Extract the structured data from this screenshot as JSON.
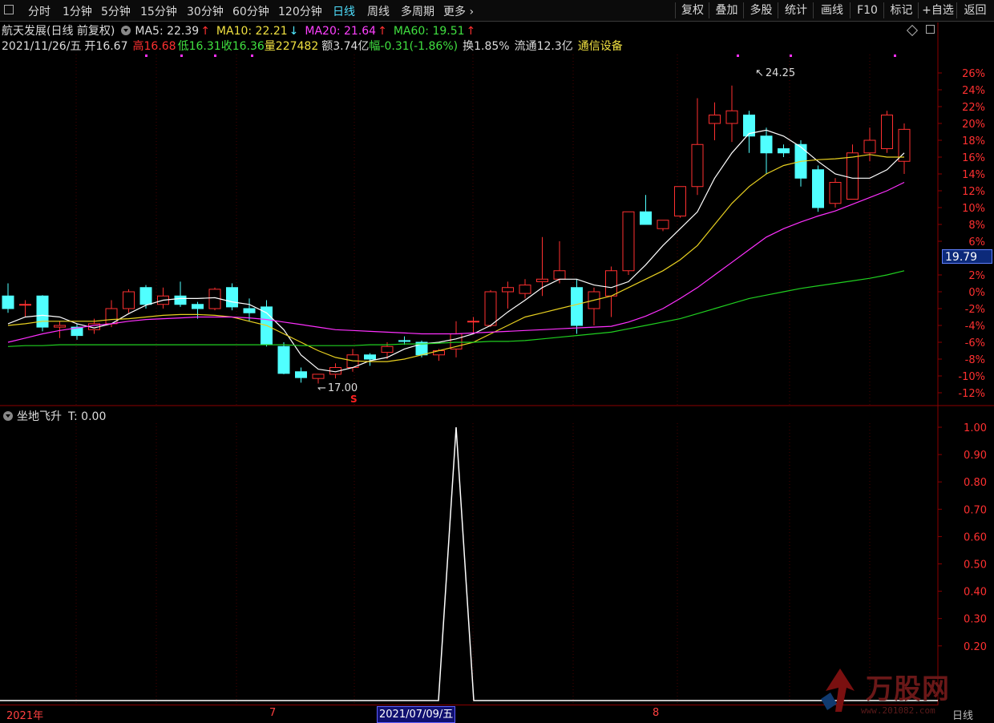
{
  "toolbar": {
    "items": [
      "分时",
      "1分钟",
      "5分钟",
      "15分钟",
      "30分钟",
      "60分钟",
      "120分钟",
      "日线",
      "周线",
      "多周期",
      "更多"
    ],
    "active": "日线",
    "more_arrow": "›",
    "right": [
      "复权",
      "叠加",
      "多股",
      "统计",
      "画线",
      "F10",
      "标记",
      "+自选",
      "返回"
    ]
  },
  "stock": {
    "title": "航天发展(日线 前复权)",
    "ma5_label": "MA5: 22.39",
    "ma10_label": "MA10: 22.21",
    "ma20_label": "MA20: 21.64",
    "ma60_label": "MA60: 19.51",
    "date": "2021/11/26/五",
    "open": "开16.67",
    "high": "高16.68",
    "low": "低16.31",
    "close": "收16.36",
    "volume": "量227482",
    "amount": "额3.74亿",
    "change": "幅-0.31(-1.86%)",
    "turnover": "换1.85%",
    "float": "流通12.3亿",
    "sector": "通信设备",
    "current_price": "19.79",
    "high_mark": "24.25",
    "low_mark": "17.00",
    "signal_mark": "S"
  },
  "price_axis": [
    "26%",
    "24%",
    "22%",
    "20%",
    "18%",
    "16%",
    "14%",
    "12%",
    "10%",
    "8%",
    "6%",
    "2%",
    "0%",
    "-2%",
    "-4%",
    "-6%",
    "-8%",
    "-10%",
    "-12%"
  ],
  "indicator": {
    "name": "坐地飞升",
    "value": "T: 0.00",
    "axis": [
      "1.00",
      "0.90",
      "0.80",
      "0.70",
      "0.60",
      "0.50",
      "0.40",
      "0.30",
      "0.20"
    ]
  },
  "date_axis": {
    "year": "2021年",
    "m7": "7",
    "selected": "2021/07/09/五",
    "m8": "8",
    "period": "日线"
  },
  "watermark": {
    "text": "万股网",
    "url": "www.201082.com"
  },
  "colors": {
    "up": "#ff3030",
    "down": "#50ffff",
    "ma5": "#ffffff",
    "ma10": "#e8d020",
    "ma20": "#ff30ff",
    "ma60": "#20d020"
  },
  "chart_data": {
    "type": "candlestick",
    "y_unit": "% change",
    "ylim": [
      -13,
      27
    ],
    "candles_ohlc": [
      [
        -0.5,
        1.0,
        -2.5,
        -2.0
      ],
      [
        -1.5,
        -1.0,
        -3.0,
        -1.5
      ],
      [
        -0.5,
        -0.4,
        -4.7,
        -4.2
      ],
      [
        -4.2,
        -3.5,
        -5.5,
        -4.0
      ],
      [
        -4.2,
        -3.8,
        -5.7,
        -5.2
      ],
      [
        -4.5,
        -3.2,
        -5.0,
        -3.8
      ],
      [
        -3.8,
        -1.0,
        -4.2,
        -2.0
      ],
      [
        -2.0,
        0.3,
        -2.5,
        0.0
      ],
      [
        0.5,
        0.8,
        -2.0,
        -1.5
      ],
      [
        -1.5,
        0.5,
        -2.0,
        -0.5
      ],
      [
        -0.5,
        1.2,
        -1.8,
        -1.5
      ],
      [
        -1.5,
        -1.2,
        -3.2,
        -2.0
      ],
      [
        -2.0,
        0.5,
        -2.2,
        0.3
      ],
      [
        0.5,
        1.0,
        -2.2,
        -1.8
      ],
      [
        -2.0,
        -0.8,
        -3.5,
        -2.5
      ],
      [
        -1.8,
        -1.0,
        -6.5,
        -6.2
      ],
      [
        -6.5,
        -6.0,
        -9.8,
        -9.7
      ],
      [
        -9.5,
        -9.0,
        -10.8,
        -10.2
      ],
      [
        -10.3,
        -9.8,
        -10.9,
        -9.8
      ],
      [
        -9.8,
        -8.5,
        -10.3,
        -9.0
      ],
      [
        -9.0,
        -6.8,
        -9.5,
        -7.5
      ],
      [
        -7.5,
        -7.3,
        -8.8,
        -8.0
      ],
      [
        -7.2,
        -6.0,
        -8.0,
        -6.5
      ],
      [
        -5.8,
        -5.3,
        -6.3,
        -5.9
      ],
      [
        -6.0,
        -5.8,
        -7.8,
        -7.5
      ],
      [
        -7.5,
        -6.8,
        -8.2,
        -7.0
      ],
      [
        -6.8,
        -3.5,
        -7.8,
        -5.0
      ],
      [
        -3.5,
        -3.0,
        -5.0,
        -3.5
      ],
      [
        -4.0,
        0.2,
        -4.2,
        0.0
      ],
      [
        0.0,
        1.2,
        -2.0,
        0.5
      ],
      [
        -0.2,
        1.5,
        -0.8,
        0.8
      ],
      [
        1.2,
        6.5,
        -0.5,
        1.5
      ],
      [
        1.5,
        6.0,
        1.0,
        2.5
      ],
      [
        0.5,
        1.5,
        -5.0,
        -4.0
      ],
      [
        -2.0,
        0.5,
        -4.0,
        0.0
      ],
      [
        -0.5,
        3.0,
        -3.0,
        2.5
      ],
      [
        2.5,
        9.5,
        2.0,
        9.5
      ],
      [
        9.5,
        11.5,
        8.5,
        8.0
      ],
      [
        7.5,
        8.5,
        7.2,
        8.5
      ],
      [
        9.0,
        12.5,
        8.8,
        12.5
      ],
      [
        12.5,
        23.0,
        11.5,
        17.5
      ],
      [
        20.0,
        22.5,
        18.0,
        21.0
      ],
      [
        20.0,
        24.5,
        17.8,
        21.5
      ],
      [
        21.0,
        21.5,
        16.5,
        18.5
      ],
      [
        18.5,
        19.5,
        14.0,
        16.5
      ],
      [
        17.0,
        17.5,
        16.0,
        16.5
      ],
      [
        17.5,
        18.0,
        12.5,
        13.5
      ],
      [
        14.5,
        15.0,
        9.5,
        10.0
      ],
      [
        10.5,
        13.5,
        10.0,
        13.0
      ],
      [
        11.0,
        17.5,
        11.0,
        16.5
      ],
      [
        16.5,
        19.5,
        15.5,
        18.0
      ],
      [
        17.0,
        21.5,
        16.5,
        21.0
      ],
      [
        15.5,
        20.0,
        14.0,
        19.3
      ]
    ],
    "ma5": [
      -3.8,
      -3.0,
      -2.8,
      -3.0,
      -3.8,
      -4.3,
      -3.8,
      -2.6,
      -1.6,
      -1.0,
      -0.8,
      -0.8,
      -0.7,
      -1.2,
      -1.5,
      -2.5,
      -4.5,
      -7.5,
      -9.2,
      -9.5,
      -9.0,
      -8.2,
      -7.8,
      -6.8,
      -6.2,
      -6.0,
      -5.6,
      -5.0,
      -4.0,
      -2.4,
      -1.0,
      0.5,
      1.5,
      1.5,
      0.8,
      0.5,
      1.2,
      3.2,
      5.5,
      7.5,
      9.5,
      13.5,
      16.5,
      18.8,
      19.2,
      18.5,
      17.2,
      15.5,
      14.0,
      13.5,
      13.5,
      14.5,
      16.5
    ],
    "ma10": [
      -4.0,
      -3.8,
      -3.5,
      -3.5,
      -3.5,
      -3.5,
      -3.3,
      -3.2,
      -3.0,
      -2.8,
      -2.7,
      -2.7,
      -2.8,
      -3.0,
      -3.5,
      -4.0,
      -5.0,
      -6.0,
      -7.0,
      -7.8,
      -8.2,
      -8.3,
      -8.3,
      -8.0,
      -7.5,
      -7.0,
      -6.5,
      -6.0,
      -5.0,
      -4.0,
      -3.0,
      -2.5,
      -2.0,
      -1.5,
      -1.0,
      -0.5,
      0.5,
      1.5,
      2.5,
      3.8,
      5.5,
      8.0,
      10.5,
      12.5,
      14.0,
      15.0,
      15.5,
      15.7,
      15.8,
      16.0,
      16.3,
      16.0,
      16.0
    ],
    "ma20": [
      -6.0,
      -5.5,
      -5.0,
      -4.6,
      -4.3,
      -4.0,
      -3.8,
      -3.5,
      -3.3,
      -3.2,
      -3.1,
      -3.0,
      -3.0,
      -3.0,
      -3.1,
      -3.3,
      -3.6,
      -3.9,
      -4.2,
      -4.5,
      -4.6,
      -4.7,
      -4.8,
      -4.9,
      -5.0,
      -5.0,
      -5.0,
      -4.9,
      -4.8,
      -4.7,
      -4.6,
      -4.5,
      -4.4,
      -4.3,
      -4.2,
      -4.1,
      -3.6,
      -2.9,
      -2.0,
      -0.8,
      0.5,
      2.0,
      3.5,
      5.0,
      6.5,
      7.5,
      8.3,
      9.0,
      9.6,
      10.4,
      11.2,
      12.0,
      13.0
    ],
    "ma60": [
      -6.5,
      -6.4,
      -6.4,
      -6.3,
      -6.3,
      -6.3,
      -6.3,
      -6.3,
      -6.3,
      -6.3,
      -6.3,
      -6.3,
      -6.3,
      -6.3,
      -6.3,
      -6.3,
      -6.3,
      -6.4,
      -6.4,
      -6.4,
      -6.4,
      -6.3,
      -6.3,
      -6.2,
      -6.2,
      -6.1,
      -6.0,
      -6.0,
      -5.9,
      -5.9,
      -5.8,
      -5.6,
      -5.4,
      -5.2,
      -5.0,
      -4.8,
      -4.4,
      -4.0,
      -3.6,
      -3.2,
      -2.6,
      -2.0,
      -1.4,
      -0.8,
      -0.4,
      0.0,
      0.4,
      0.7,
      1.0,
      1.3,
      1.6,
      2.0,
      2.5
    ],
    "indicator_series": [
      0,
      0,
      0,
      0,
      0,
      0,
      0,
      0,
      0,
      0,
      0,
      0,
      0,
      0,
      0,
      0,
      0,
      0,
      0,
      0,
      0,
      0,
      0,
      0,
      0,
      0,
      1,
      0,
      0,
      0,
      0,
      0,
      0,
      0,
      0,
      0,
      0,
      0,
      0,
      0,
      0,
      0,
      0,
      0,
      0,
      0,
      0,
      0,
      0,
      0,
      0,
      0,
      0
    ],
    "indicator_ylim": [
      0,
      1.05
    ]
  }
}
